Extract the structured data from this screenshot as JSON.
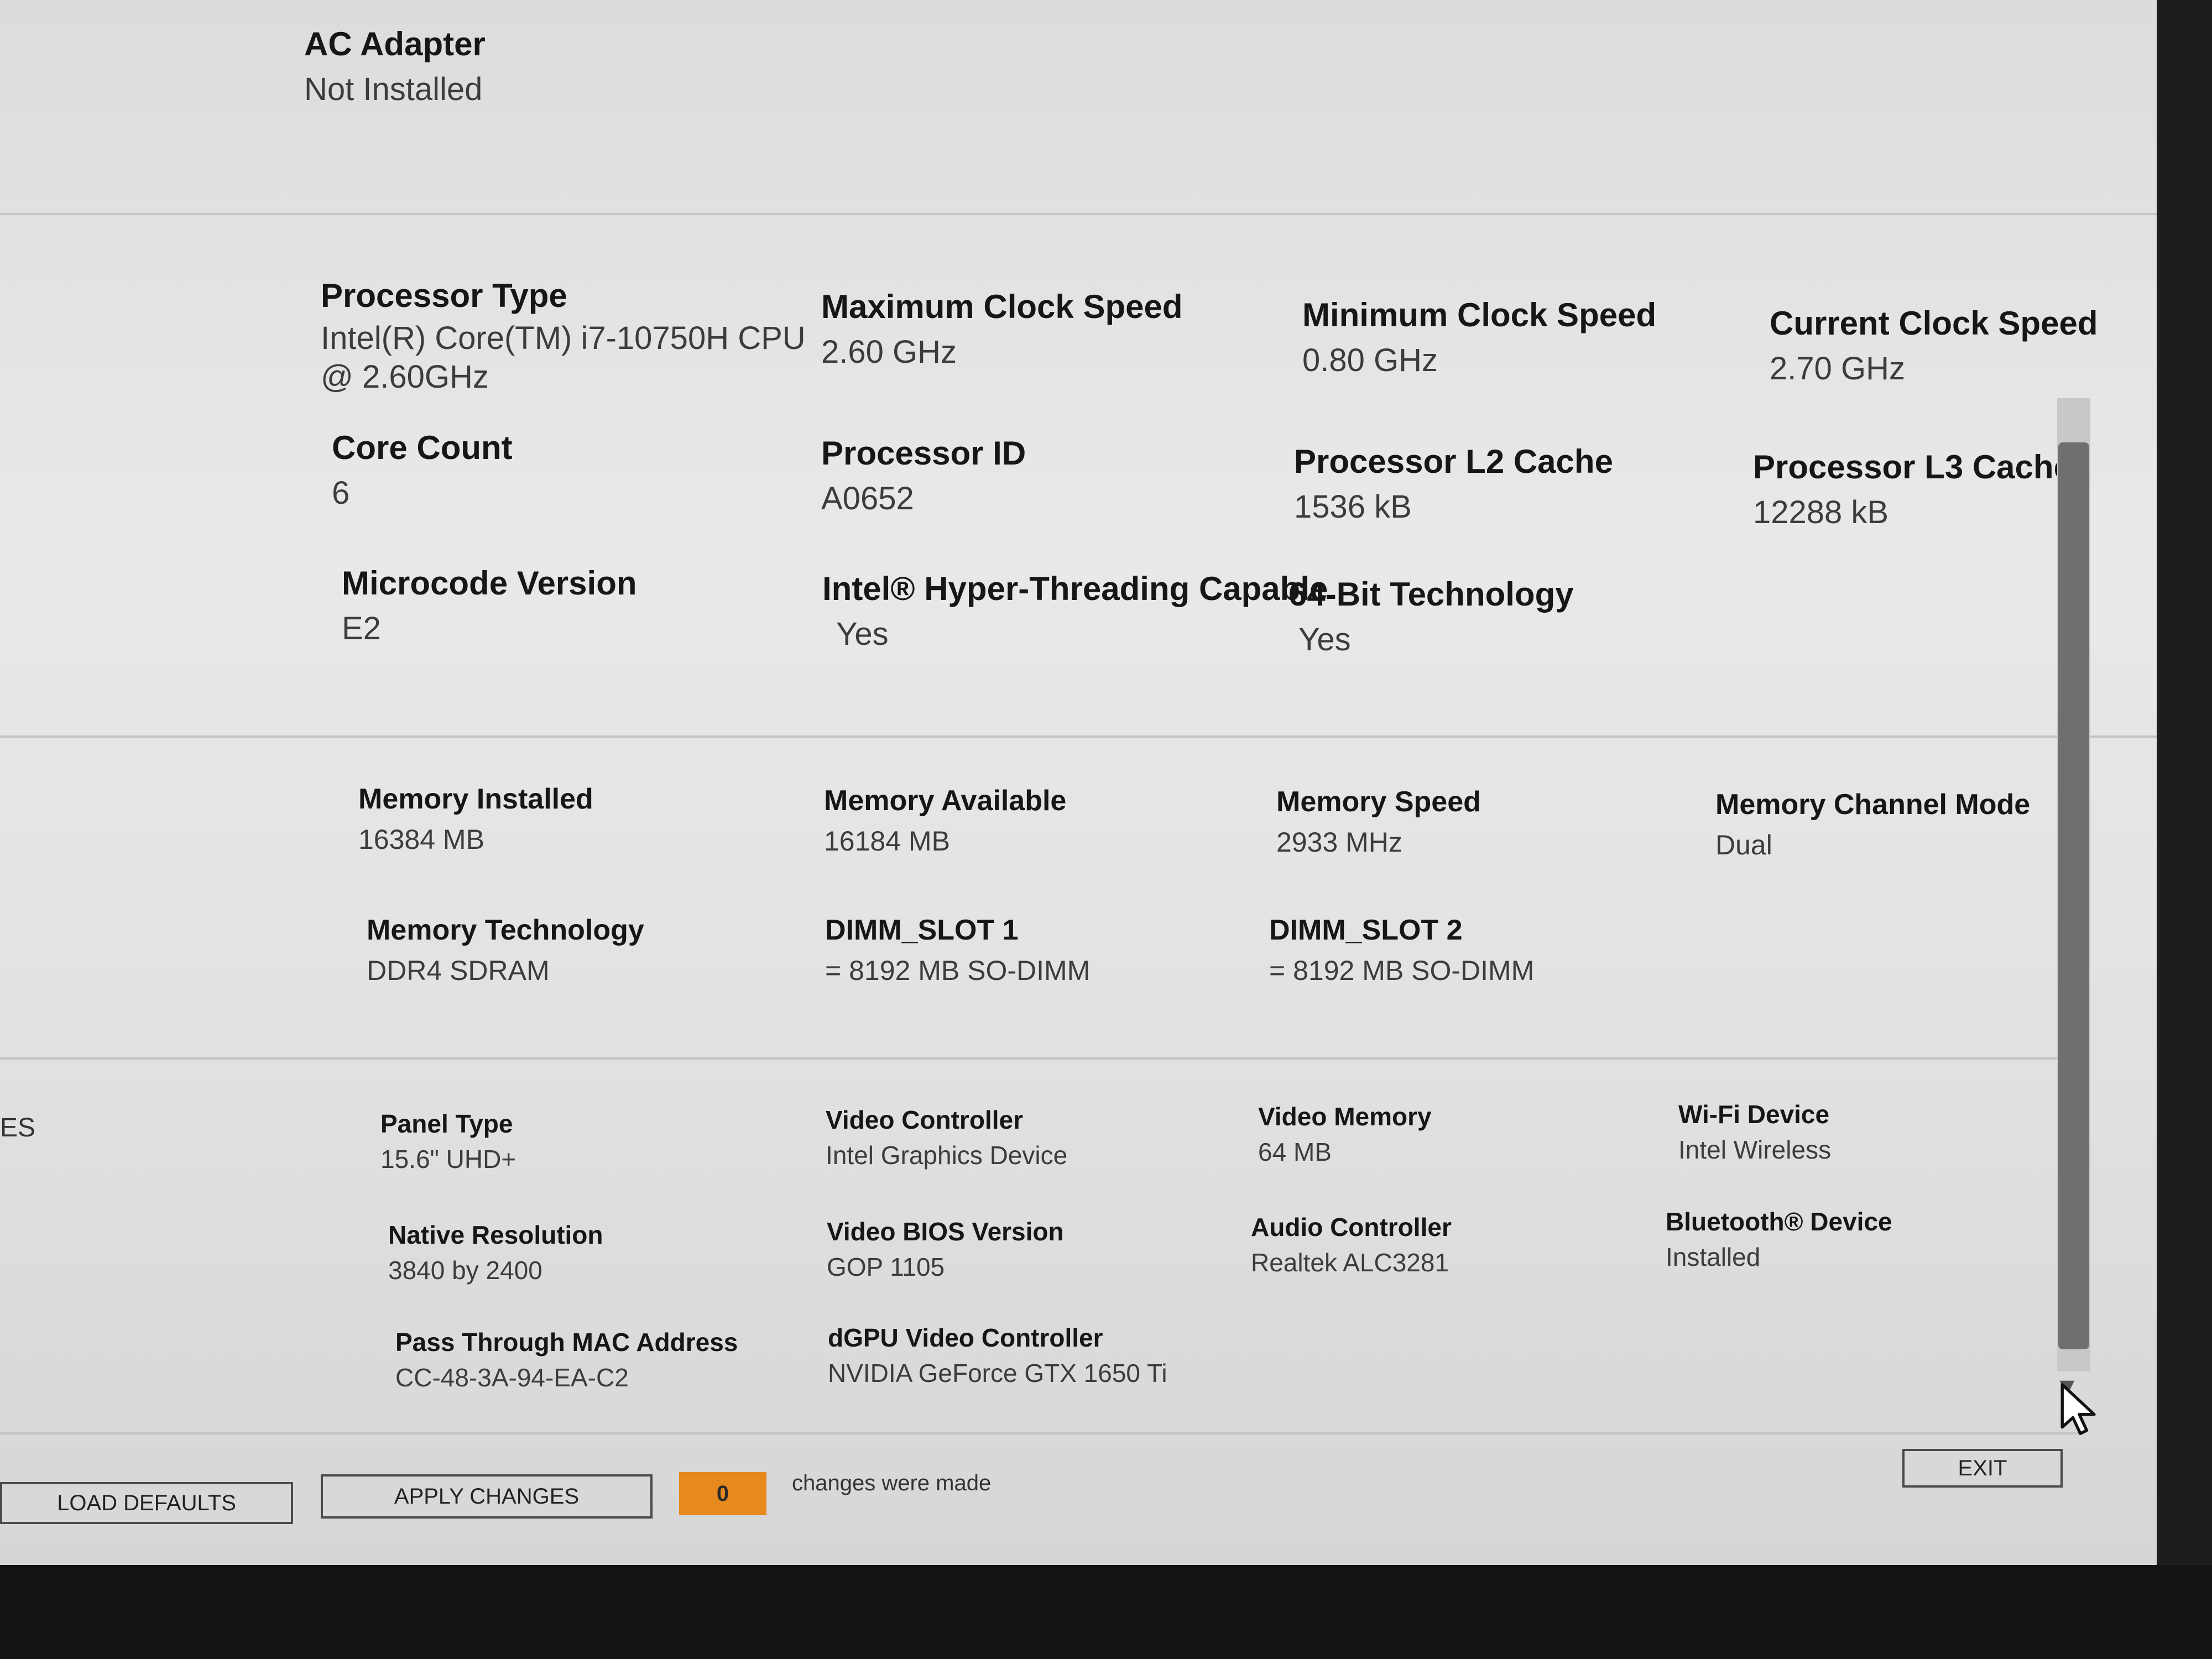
{
  "power": {
    "ac_adapter": {
      "label": "AC Adapter",
      "value": "Not Installed"
    }
  },
  "processor": {
    "processor_type": {
      "label": "Processor Type",
      "value": "Intel(R) Core(TM) i7-10750H CPU @ 2.60GHz"
    },
    "max_clock_speed": {
      "label": "Maximum Clock Speed",
      "value": "2.60 GHz"
    },
    "min_clock_speed": {
      "label": "Minimum Clock Speed",
      "value": "0.80 GHz"
    },
    "current_clock_speed": {
      "label": "Current Clock Speed",
      "value": "2.70 GHz"
    },
    "core_count": {
      "label": "Core Count",
      "value": "6"
    },
    "processor_id": {
      "label": "Processor ID",
      "value": "A0652"
    },
    "l2_cache": {
      "label": "Processor L2 Cache",
      "value": "1536 kB"
    },
    "l3_cache": {
      "label": "Processor L3 Cache",
      "value": "12288 kB"
    },
    "microcode_version": {
      "label": "Microcode Version",
      "value": "E2"
    },
    "hyper_threading": {
      "label": "Intel® Hyper-Threading Capable",
      "value": "Yes"
    },
    "bit64": {
      "label": "64-Bit Technology",
      "value": "Yes"
    }
  },
  "memory": {
    "installed": {
      "label": "Memory Installed",
      "value": "16384 MB"
    },
    "available": {
      "label": "Memory Available",
      "value": "16184 MB"
    },
    "speed": {
      "label": "Memory Speed",
      "value": "2933 MHz"
    },
    "channel_mode": {
      "label": "Memory Channel Mode",
      "value": "Dual"
    },
    "technology": {
      "label": "Memory Technology",
      "value": "DDR4 SDRAM"
    },
    "dimm1": {
      "label": "DIMM_SLOT 1",
      "value": "= 8192 MB SO-DIMM"
    },
    "dimm2": {
      "label": "DIMM_SLOT 2",
      "value": "= 8192 MB SO-DIMM"
    }
  },
  "devices": {
    "side_label": "ES",
    "panel_type": {
      "label": "Panel Type",
      "value": "15.6\" UHD+"
    },
    "video_controller": {
      "label": "Video Controller",
      "value": "Intel Graphics Device"
    },
    "video_memory": {
      "label": "Video Memory",
      "value": "64 MB"
    },
    "wifi_device": {
      "label": "Wi-Fi Device",
      "value": "Intel Wireless"
    },
    "native_resolution": {
      "label": "Native Resolution",
      "value": "3840 by 2400"
    },
    "video_bios": {
      "label": "Video BIOS Version",
      "value": "GOP 1105"
    },
    "audio_controller": {
      "label": "Audio Controller",
      "value": "Realtek ALC3281"
    },
    "bluetooth_device": {
      "label": "Bluetooth® Device",
      "value": "Installed"
    },
    "mac_address": {
      "label": "Pass Through MAC Address",
      "value": "CC-48-3A-94-EA-C2"
    },
    "dgpu_controller": {
      "label": "dGPU Video Controller",
      "value": "NVIDIA GeForce GTX 1650 Ti"
    }
  },
  "footer": {
    "load_defaults": "LOAD DEFAULTS",
    "apply_changes": "APPLY CHANGES",
    "change_count": "0",
    "changes_text": "changes were made",
    "exit": "EXIT"
  },
  "colors": {
    "counter_badge": "#e8891d",
    "background": "#e6e6e6"
  }
}
